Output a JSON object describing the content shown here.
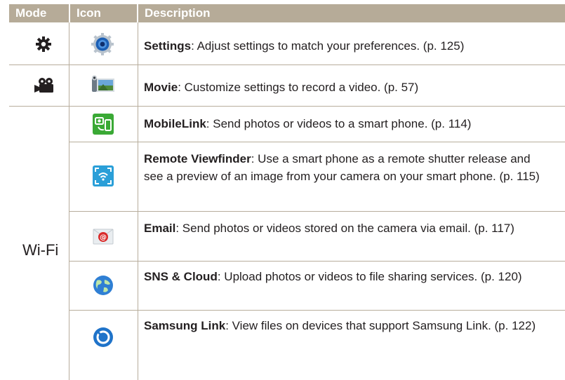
{
  "header": {
    "mode": "Mode",
    "icon": "Icon",
    "description": "Description"
  },
  "rows": [
    {
      "mode_icon": "gear-icon",
      "icon": "settings-icon",
      "title": "Settings",
      "text": ": Adjust settings to match your preferences. (p. 125)"
    },
    {
      "mode_icon": "movie-camera-icon",
      "icon": "movie-icon",
      "title": "Movie",
      "text": ": Customize settings to record a video. (p. 57)"
    },
    {
      "icon": "mobilelink-icon",
      "title": "MobileLink",
      "text": ": Send photos or videos to a smart phone. (p. 114)"
    },
    {
      "icon": "remote-viewfinder-icon",
      "title": "Remote Viewfinder",
      "text": ": Use a smart phone as a remote shutter release and see a preview of an image from your camera on your smart phone. (p. 115)"
    },
    {
      "icon": "email-icon",
      "title": "Email",
      "text": ": Send photos or videos stored on the camera via email. (p. 117)"
    },
    {
      "icon": "sns-cloud-icon",
      "title": "SNS & Cloud",
      "text": ": Upload photos or videos to file sharing services. (p. 120)"
    },
    {
      "icon": "samsung-link-icon",
      "title": "Samsung Link",
      "text": ": View files on devices that support Samsung Link. (p. 122)"
    }
  ],
  "wifi_group": {
    "label": "Wi-Fi"
  },
  "colors": {
    "header_bg": "#b6ab98",
    "rule": "#b7ad9c",
    "text": "#231f20"
  }
}
